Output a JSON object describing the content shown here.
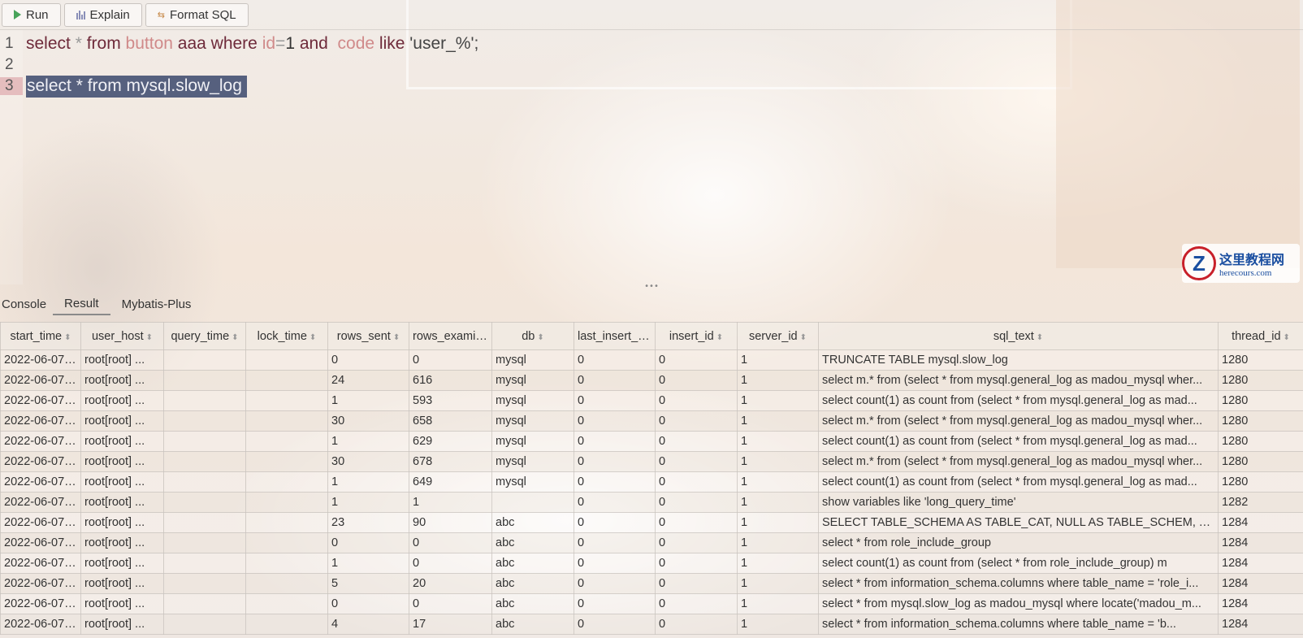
{
  "toolbar": {
    "run_label": "Run",
    "explain_label": "Explain",
    "format_label": "Format SQL"
  },
  "editor": {
    "lines": [
      {
        "number": "1"
      },
      {
        "number": "2"
      },
      {
        "number": "3"
      }
    ],
    "line1": {
      "t1": "select",
      "t2": " * ",
      "t3": "from",
      "t4": " button",
      "t5": " aaa ",
      "t6": "where",
      "t7": " id",
      "t8": "=",
      "t9": "1 ",
      "t10": "and",
      "t11": "  code ",
      "t12": "like",
      "t13": " 'user_%';"
    },
    "line3_selected": "select * from mysql.slow_log"
  },
  "bottom_tabs": [
    "Console",
    "Result",
    "Mybatis-Plus"
  ],
  "result": {
    "columns": [
      "start_time",
      "user_host",
      "query_time",
      "lock_time",
      "rows_sent",
      "rows_examinec",
      "db",
      "last_insert_id",
      "insert_id",
      "server_id",
      "sql_text",
      "thread_id"
    ],
    "rows": [
      [
        "2022-06-07 ...",
        "root[root] ...",
        "",
        "",
        "0",
        "0",
        "mysql",
        "0",
        "0",
        "1",
        "TRUNCATE TABLE mysql.slow_log",
        "1280"
      ],
      [
        "2022-06-07 ...",
        "root[root] ...",
        "",
        "",
        "24",
        "616",
        "mysql",
        "0",
        "0",
        "1",
        "select m.* from (select * from mysql.general_log as madou_mysql wher...",
        "1280"
      ],
      [
        "2022-06-07 ...",
        "root[root] ...",
        "",
        "",
        "1",
        "593",
        "mysql",
        "0",
        "0",
        "1",
        "select count(1) as count from (select * from mysql.general_log as mad...",
        "1280"
      ],
      [
        "2022-06-07 ...",
        "root[root] ...",
        "",
        "",
        "30",
        "658",
        "mysql",
        "0",
        "0",
        "1",
        "select m.* from (select * from mysql.general_log as madou_mysql wher...",
        "1280"
      ],
      [
        "2022-06-07 ...",
        "root[root] ...",
        "",
        "",
        "1",
        "629",
        "mysql",
        "0",
        "0",
        "1",
        "select count(1) as count from (select * from mysql.general_log as mad...",
        "1280"
      ],
      [
        "2022-06-07 ...",
        "root[root] ...",
        "",
        "",
        "30",
        "678",
        "mysql",
        "0",
        "0",
        "1",
        "select m.* from (select * from mysql.general_log as madou_mysql wher...",
        "1280"
      ],
      [
        "2022-06-07 ...",
        "root[root] ...",
        "",
        "",
        "1",
        "649",
        "mysql",
        "0",
        "0",
        "1",
        "select count(1) as count from (select * from mysql.general_log as mad...",
        "1280"
      ],
      [
        "2022-06-07 ...",
        "root[root] ...",
        "",
        "",
        "1",
        "1",
        "",
        "0",
        "0",
        "1",
        "show variables like 'long_query_time'",
        "1282"
      ],
      [
        "2022-06-07 ...",
        "root[root] ...",
        "",
        "",
        "23",
        "90",
        "abc",
        "0",
        "0",
        "1",
        "SELECT TABLE_SCHEMA AS TABLE_CAT, NULL AS TABLE_SCHEM, TABL...",
        "1284"
      ],
      [
        "2022-06-07 ...",
        "root[root] ...",
        "",
        "",
        "0",
        "0",
        "abc",
        "0",
        "0",
        "1",
        "select * from role_include_group",
        "1284"
      ],
      [
        "2022-06-07 ...",
        "root[root] ...",
        "",
        "",
        "1",
        "0",
        "abc",
        "0",
        "0",
        "1",
        "select count(1) as count from (select * from role_include_group) m",
        "1284"
      ],
      [
        "2022-06-07 ...",
        "root[root] ...",
        "",
        "",
        "5",
        "20",
        "abc",
        "0",
        "0",
        "1",
        "select * from information_schema.columns where table_name = 'role_i...",
        "1284"
      ],
      [
        "2022-06-07 ...",
        "root[root] ...",
        "",
        "",
        "0",
        "0",
        "abc",
        "0",
        "0",
        "1",
        "select * from mysql.slow_log as madou_mysql where locate('madou_m...",
        "1284"
      ],
      [
        "2022-06-07 ...",
        "root[root] ...",
        "",
        "",
        "4",
        "17",
        "abc",
        "0",
        "0",
        "1",
        "select * from information_schema.columns where table_name = 'b...",
        "1284"
      ]
    ]
  },
  "watermark": {
    "text": "这里教程网",
    "url": "herecours.com"
  }
}
